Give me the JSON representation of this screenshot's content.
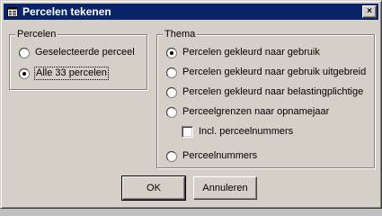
{
  "window": {
    "title": "Percelen tekenen",
    "close_label": "×"
  },
  "percelen": {
    "label": "Percelen",
    "options": [
      {
        "label": "Geselecteerde perceel",
        "selected": false
      },
      {
        "label": "Alle 33 percelen",
        "selected": true
      }
    ]
  },
  "thema": {
    "label": "Thema",
    "options": [
      {
        "label": "Percelen gekleurd naar gebruik",
        "selected": true
      },
      {
        "label": "Percelen gekleurd naar gebruik uitgebreid",
        "selected": false
      },
      {
        "label": "Percelen gekleurd naar belastingplichtige",
        "selected": false
      },
      {
        "label": "Perceelgrenzen naar opnamejaar",
        "selected": false
      },
      {
        "label": "Perceelnummers",
        "selected": false
      }
    ],
    "checkbox": {
      "label": "Incl. perceelnummers",
      "checked": false
    }
  },
  "buttons": {
    "ok": "OK",
    "cancel": "Annuleren"
  }
}
